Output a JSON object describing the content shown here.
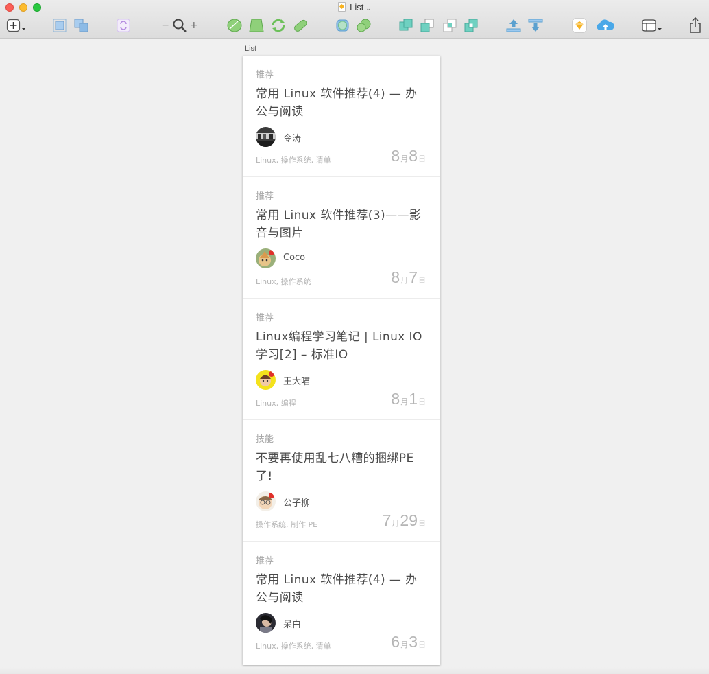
{
  "window": {
    "title": "List"
  },
  "toolbar": {
    "insert_icon": "plus-dropdown-icon",
    "zoom_minus": "−",
    "zoom_plus": "+",
    "colors": {
      "green": "#7cc36b",
      "teal": "#5ec8b8",
      "blue": "#4aa8e8",
      "sketch": "#f7b21f",
      "purple": "#b48ae0"
    }
  },
  "artboard": {
    "label": "List"
  },
  "cards": [
    {
      "tag": "推荐",
      "title": "常用 Linux 软件推荐(4) — 办公与阅读",
      "author": "令涛",
      "avatar_icon": "avatar-dark-photo",
      "meta": "Linux, 操作系统, 清单",
      "month": "8",
      "day": "8",
      "month_unit": "月",
      "day_unit": "日"
    },
    {
      "tag": "推荐",
      "title": "常用 Linux 软件推荐(3)——影音与图片",
      "author": "Coco",
      "avatar_icon": "avatar-cartoon-green",
      "meta": "Linux, 操作系统",
      "month": "8",
      "day": "7",
      "month_unit": "月",
      "day_unit": "日"
    },
    {
      "tag": "推荐",
      "title": "Linux编程学习笔记 | Linux IO学习[2] – 标准IO",
      "author": "王大喵",
      "avatar_icon": "avatar-cartoon-yellow",
      "meta": "Linux, 编程",
      "month": "8",
      "day": "1",
      "month_unit": "月",
      "day_unit": "日"
    },
    {
      "tag": "技能",
      "title": "不要再使用乱七八糟的捆绑PE了!",
      "author": "公子柳",
      "avatar_icon": "avatar-cartoon-glasses",
      "meta": "操作系统, 制作 PE",
      "month": "7",
      "day": "29",
      "month_unit": "月",
      "day_unit": "日"
    },
    {
      "tag": "推荐",
      "title": "常用 Linux 软件推荐(4) — 办公与阅读",
      "author": "呆白",
      "avatar_icon": "avatar-dark-photo-2",
      "meta": "Linux, 操作系统, 清单",
      "month": "6",
      "day": "3",
      "month_unit": "月",
      "day_unit": "日"
    }
  ]
}
